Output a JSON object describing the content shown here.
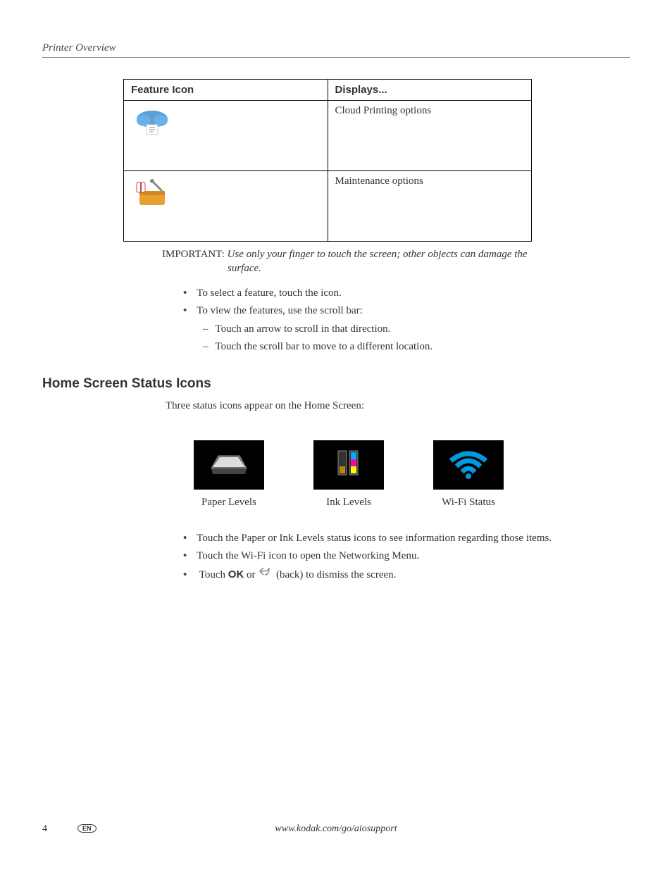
{
  "header": "Printer Overview",
  "table": {
    "col1": "Feature Icon",
    "col2": "Displays...",
    "rows": [
      {
        "icon": "cloud-print-icon",
        "displays": "Cloud Printing options"
      },
      {
        "icon": "toolbox-icon",
        "displays": "Maintenance options"
      }
    ]
  },
  "important": {
    "label": "IMPORTANT:",
    "text1": "Use only your finger to touch the screen; other objects can damage the",
    "text2": "surface."
  },
  "bullets1": {
    "b1": "To select a feature, touch the icon.",
    "b2": "To view the features, use the scroll bar:",
    "s1": "Touch an arrow to scroll in that direction.",
    "s2": "Touch the scroll bar to move to a different location."
  },
  "section2": {
    "heading": "Home Screen Status Icons",
    "intro": "Three status icons appear on the Home Screen:",
    "icons": {
      "paper": "Paper Levels",
      "ink": "Ink Levels",
      "wifi": "Wi-Fi Status"
    }
  },
  "bullets2": {
    "b1": "Touch the Paper or Ink Levels status icons to see information regarding those items.",
    "b2": "Touch the Wi-Fi icon to open the Networking Menu.",
    "b3a": "Touch ",
    "b3ok": "OK",
    "b3b": " or ",
    "b3c": " (back) to dismiss the screen."
  },
  "footer": {
    "page": "4",
    "lang": "EN",
    "url": "www.kodak.com/go/aiosupport"
  }
}
